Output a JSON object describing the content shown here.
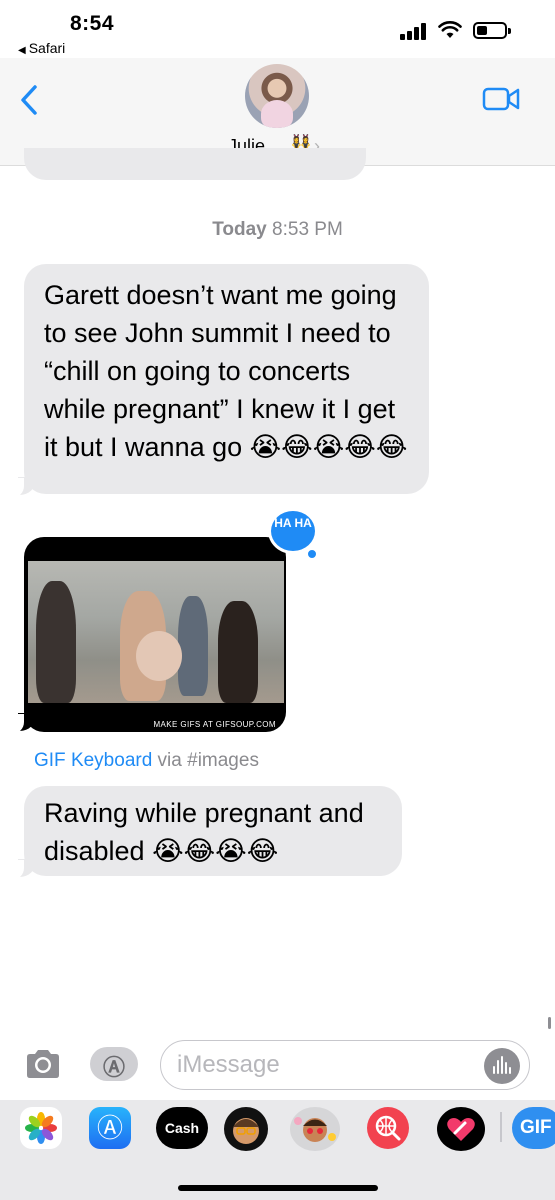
{
  "status_bar": {
    "time": "8:54",
    "back_app": "Safari"
  },
  "header": {
    "contact_name": "Julie",
    "contact_emoji": "👯‍♀️",
    "chevron": "›",
    "back_icon": "chevron-left-icon",
    "video_icon": "video-camera-icon"
  },
  "conversation": {
    "timestamp_day": "Today",
    "timestamp_time": "8:53 PM",
    "message_1": "Garett doesn’t want me going to see John summit I need to “chill on going to concerts while pregnant” I knew it I get it but I wanna go 😭😂😭😂😂",
    "gif_caption": "MAKE GIFS AT GIFSOUP.COM",
    "tapback": "HA HA",
    "gif_source_link": "GIF Keyboard",
    "gif_source_via": " via #images",
    "message_2": "Raving while pregnant and disabled 😭😂😭😂"
  },
  "input_bar": {
    "placeholder": "iMessage"
  },
  "app_drawer": {
    "apps": [
      "Photos",
      "App Store",
      "Cash",
      "Memoji",
      "Memoji Stickers",
      "Images",
      "Digital Touch",
      "GIF"
    ],
    "cash_label": "Cash",
    "gif_label": "GIF"
  },
  "colors": {
    "accent": "#1F8BF5",
    "bubble_gray": "#E9E9EB",
    "timestamp_gray": "#8A8A8E"
  }
}
